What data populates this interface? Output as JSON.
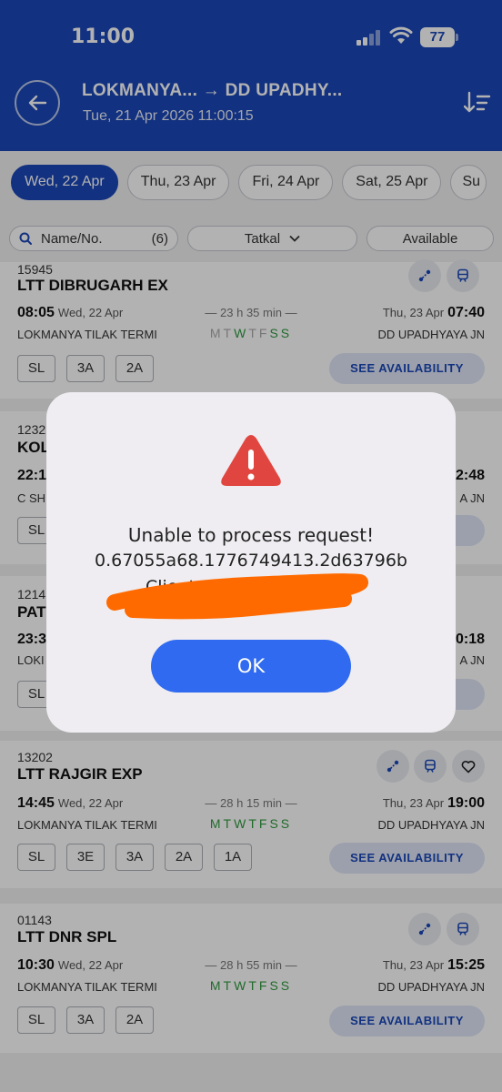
{
  "status_bar": {
    "time": "11:00",
    "battery": "77"
  },
  "header": {
    "route": "LOKMANYA... → DD UPADHY...",
    "datetime": "Tue, 21 Apr 2026 11:00:15"
  },
  "dates": [
    "Wed, 22 Apr",
    "Thu, 23 Apr",
    "Fri, 24 Apr",
    "Sat, 25 Apr",
    "Su"
  ],
  "filters": {
    "search_placeholder": "Name/No.",
    "count": "(6)",
    "quota": "Tatkal",
    "availability": "Available"
  },
  "trains": [
    {
      "number": "15945",
      "name": "LTT DIBRUGARH EX",
      "dep_time": "08:05",
      "dep_date": "Wed, 22 Apr",
      "duration": "23 h 35 min",
      "days": [
        "M",
        "T",
        "W",
        "T",
        "F",
        "S",
        "S"
      ],
      "arr_date": "Thu, 23 Apr",
      "arr_time": "07:40",
      "from": "LOKMANYA TILAK TERMI",
      "to": "DD UPADHYAYA JN",
      "classes": [
        "SL",
        "3A",
        "2A"
      ],
      "cta": "SEE AVAILABILITY"
    },
    {
      "number": "1232",
      "name": "KOL",
      "dep_time": "22:1",
      "from": "C SH",
      "arr_time": "2:48",
      "to": "A JN",
      "classes": [
        "SL"
      ],
      "cta": "Y"
    },
    {
      "number": "1214",
      "name": "PAT",
      "dep_time": "23:3",
      "from": "LOKI",
      "arr_time": "0:18",
      "to": "A JN",
      "classes": [
        "SL"
      ],
      "cta": "Y"
    },
    {
      "number": "13202",
      "name": "LTT RAJGIR EXP",
      "dep_time": "14:45",
      "dep_date": "Wed, 22 Apr",
      "duration": "28 h 15 min",
      "days": [
        "M",
        "T",
        "W",
        "T",
        "F",
        "S",
        "S"
      ],
      "arr_date": "Thu, 23 Apr",
      "arr_time": "19:00",
      "from": "LOKMANYA TILAK TERMI",
      "to": "DD UPADHYAYA JN",
      "classes": [
        "SL",
        "3E",
        "3A",
        "2A",
        "1A"
      ],
      "cta": "SEE AVAILABILITY"
    },
    {
      "number": "01143",
      "name": "LTT DNR SPL",
      "dep_time": "10:30",
      "dep_date": "Wed, 22 Apr",
      "duration": "28 h 55 min",
      "days": [
        "M",
        "T",
        "W",
        "T",
        "F",
        "S",
        "S"
      ],
      "arr_date": "Thu, 23 Apr",
      "arr_time": "15:25",
      "from": "LOKMANYA TILAK TERMI",
      "to": "DD UPADHYAYA JN",
      "classes": [
        "SL",
        "3A",
        "2A"
      ],
      "cta": "SEE AVAILABILITY"
    }
  ],
  "dialog": {
    "title": "Unable to process request!",
    "code": "0.67055a68.1776749413.2d63796b",
    "client_id_visible": "Client ID: 123",
    "ok_label": "OK"
  },
  "colors": {
    "header_bg": "#1a47b8",
    "accent": "#2f6af0",
    "running_day": "#2e9a3e",
    "warning": "#e0463f",
    "redaction": "#ff6a00"
  }
}
